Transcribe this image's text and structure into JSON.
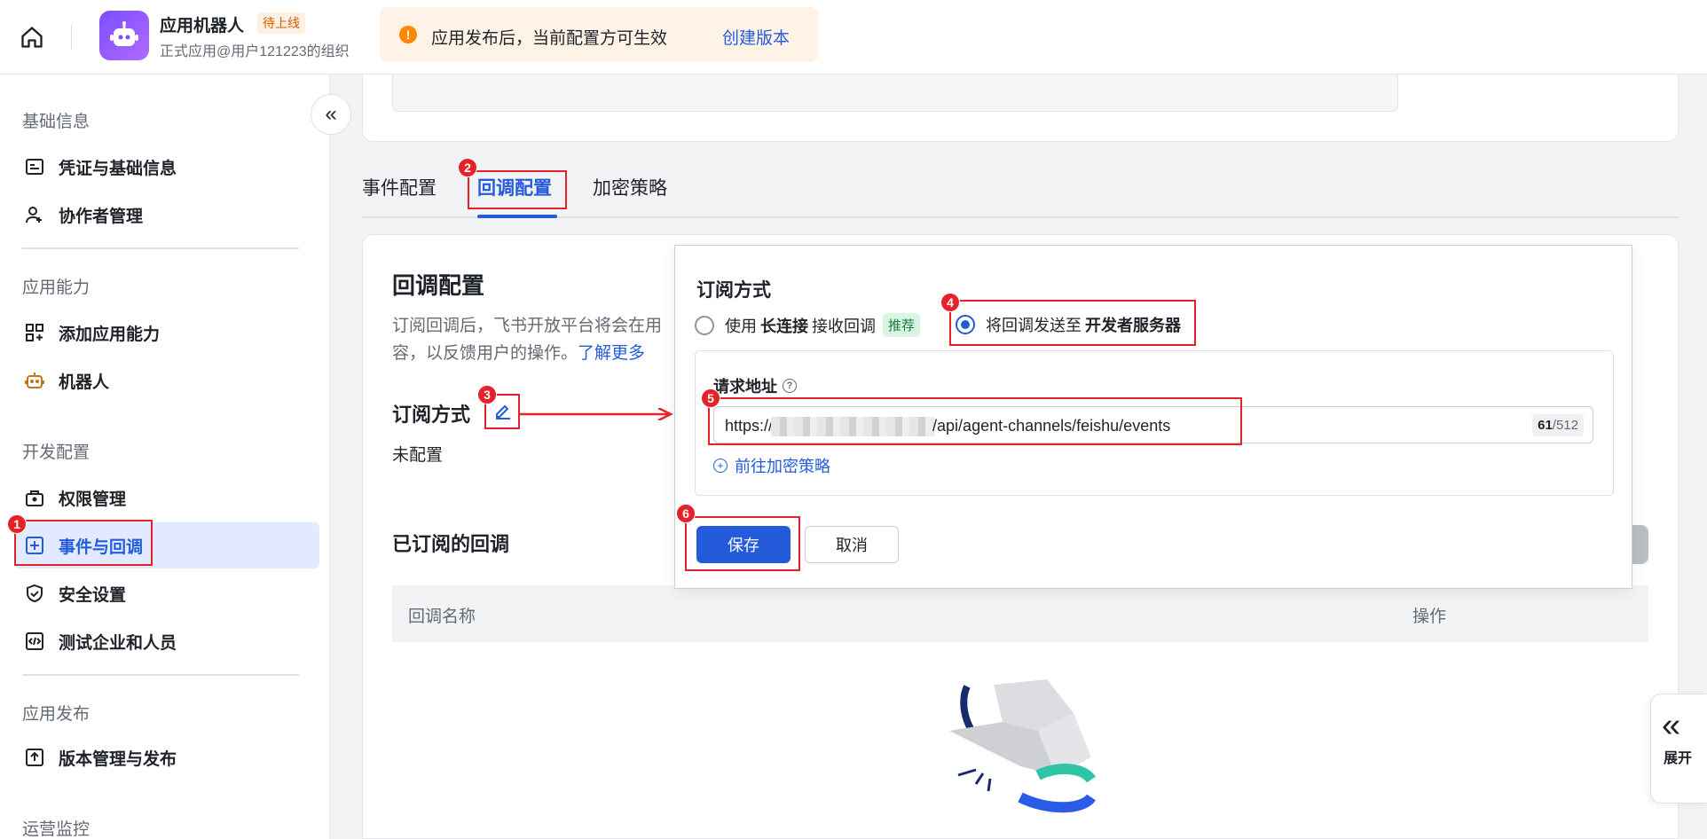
{
  "app": {
    "name": "应用机器人",
    "badge": "待上线",
    "org": "正式应用@用户121223的组织"
  },
  "notice": {
    "text": "应用发布后，当前配置方可生效",
    "link": "创建版本"
  },
  "sidebar": {
    "sections": [
      {
        "title": "基础信息",
        "items": [
          {
            "label": "凭证与基础信息",
            "icon": "credential-icon"
          },
          {
            "label": "协作者管理",
            "icon": "user-add-icon"
          }
        ]
      },
      {
        "title": "应用能力",
        "items": [
          {
            "label": "添加应用能力",
            "icon": "apps-add-icon"
          },
          {
            "label": "机器人",
            "icon": "robot-icon"
          }
        ]
      },
      {
        "title": "开发配置",
        "items": [
          {
            "label": "权限管理",
            "icon": "lock-box-icon"
          },
          {
            "label": "事件与回调",
            "icon": "event-plus-icon"
          },
          {
            "label": "安全设置",
            "icon": "shield-icon"
          },
          {
            "label": "测试企业和人员",
            "icon": "code-box-icon"
          }
        ]
      },
      {
        "title": "应用发布",
        "items": [
          {
            "label": "版本管理与发布",
            "icon": "upload-box-icon"
          }
        ]
      },
      {
        "title": "运营监控",
        "items": []
      }
    ],
    "active_item": "事件与回调"
  },
  "tabs": [
    {
      "label": "事件配置",
      "active": false
    },
    {
      "label": "回调配置",
      "active": true
    },
    {
      "label": "加密策略",
      "active": false
    }
  ],
  "main": {
    "title": "回调配置",
    "desc_prefix": "订阅回调后，飞书开放平台将会在用户操作时推送回调内容，以反馈用户的操作。",
    "desc_visible_line1": "订阅回调后，飞书开放平台将会在用",
    "desc_visible_line2": "容，以反馈用户的操作。",
    "learn_more": "了解更多",
    "subscribe_title": "订阅方式",
    "subscribe_status": "未配置",
    "subscribed_title": "已订阅的回调",
    "table_headers": {
      "name": "回调名称",
      "operation": "操作"
    }
  },
  "popover": {
    "title": "订阅方式",
    "option_long": {
      "prefix": "使用",
      "bold": "长连接",
      "suffix": "接收回调",
      "tag": "推荐",
      "checked": false
    },
    "option_server": {
      "prefix": "将回调发送至",
      "bold": "开发者服务器",
      "checked": true
    },
    "url_label": "请求地址",
    "url_prefix": "https://",
    "url_suffix": "/api/agent-channels/feishu/events",
    "counter_current": "61",
    "counter_max": "/512",
    "enc_link": "前往加密策略",
    "save": "保存",
    "cancel": "取消"
  },
  "expand": {
    "label": "展开"
  },
  "steps": [
    "1",
    "2",
    "3",
    "4",
    "5",
    "6"
  ],
  "colors": {
    "primary": "#245bdb",
    "annotation": "#e5222a",
    "warning": "#ff8800"
  }
}
